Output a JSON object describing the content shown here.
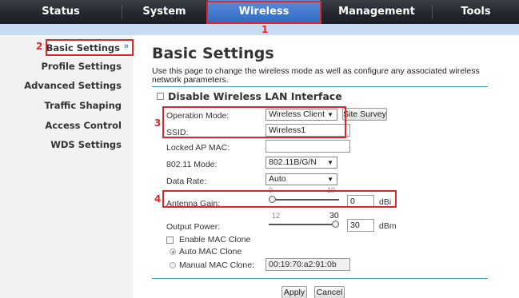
{
  "nav": {
    "status": "Status",
    "system": "System",
    "wireless": "Wireless",
    "management": "Management",
    "tools": "Tools"
  },
  "annotations": {
    "n1": "1",
    "n2": "2",
    "n3": "3",
    "n4": "4"
  },
  "sidebar": {
    "items": [
      {
        "label": "Basic Settings"
      },
      {
        "label": "Profile Settings"
      },
      {
        "label": "Advanced Settings"
      },
      {
        "label": "Traffic Shaping"
      },
      {
        "label": "Access Control"
      },
      {
        "label": "WDS Settings"
      }
    ],
    "active_marker": "»"
  },
  "page": {
    "title": "Basic Settings",
    "description": "Use this page to change the wireless mode as well as configure any associated wireless network parameters."
  },
  "form": {
    "disable_label": "Disable Wireless LAN Interface",
    "operation_mode_label": "Operation Mode:",
    "operation_mode_value": "Wireless Client",
    "site_survey": "Site Survey",
    "ssid_label": "SSID:",
    "ssid_value": "Wireless1",
    "locked_ap_mac_label": "Locked AP MAC:",
    "locked_ap_mac_value": "",
    "mode_80211_label": "802.11 Mode:",
    "mode_80211_value": "802.11B/G/N",
    "data_rate_label": "Data Rate:",
    "data_rate_value": "Auto",
    "antenna_gain_label": "Antenna Gain:",
    "antenna_gain_min": "0",
    "antenna_gain_max": "10",
    "antenna_gain_value": "0",
    "antenna_gain_unit": "dBi",
    "antenna_gain_level": 0,
    "output_power_label": "Output Power:",
    "output_power_min": "12",
    "output_power_max": "30",
    "output_power_value": "30",
    "output_power_unit": "dBm",
    "output_power_level": 1,
    "enable_mac_clone": "Enable MAC Clone",
    "auto_mac_clone": "Auto MAC Clone",
    "manual_mac_clone": "Manual MAC Clone:",
    "manual_mac_value": "00:19:70:a2:91:0b",
    "apply": "Apply",
    "cancel": "Cancel"
  },
  "colors": {
    "accent": "#3a8fd8",
    "highlight": "#e0262b"
  }
}
